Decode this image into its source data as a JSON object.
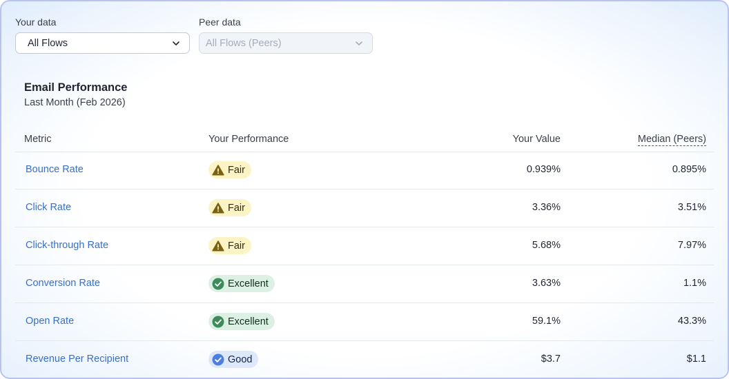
{
  "filters": {
    "your_data_label": "Your data",
    "your_data_value": "All Flows",
    "peer_data_label": "Peer data",
    "peer_data_value": "All Flows (Peers)"
  },
  "card": {
    "title": "Email Performance",
    "subtitle": "Last Month (Feb 2026)"
  },
  "table": {
    "headers": {
      "metric": "Metric",
      "performance": "Your Performance",
      "your_value": "Your Value",
      "median": "Median (Peers)"
    },
    "rows": [
      {
        "metric": "Bounce Rate",
        "rating": "Fair",
        "rating_icon": "warning-icon",
        "your_value": "0.939%",
        "median": "0.895%"
      },
      {
        "metric": "Click Rate",
        "rating": "Fair",
        "rating_icon": "warning-icon",
        "your_value": "3.36%",
        "median": "3.51%"
      },
      {
        "metric": "Click-through Rate",
        "rating": "Fair",
        "rating_icon": "warning-icon",
        "your_value": "5.68%",
        "median": "7.97%"
      },
      {
        "metric": "Conversion Rate",
        "rating": "Excellent",
        "rating_icon": "check-circle-icon",
        "your_value": "3.63%",
        "median": "1.1%"
      },
      {
        "metric": "Open Rate",
        "rating": "Excellent",
        "rating_icon": "check-circle-icon",
        "your_value": "59.1%",
        "median": "43.3%"
      },
      {
        "metric": "Revenue Per Recipient",
        "rating": "Good",
        "rating_icon": "check-circle-icon",
        "your_value": "$3.7",
        "median": "$1.1"
      }
    ]
  },
  "colors": {
    "link": "#3a6fc5",
    "fair_bg": "#fcf4c4",
    "fair_icon": "#7a6212",
    "excellent_bg": "#dcf1e3",
    "excellent_icon": "#3d8a5a",
    "good_bg": "#dde8fb",
    "good_icon": "#4d7fe0",
    "frame_border": "#b9c3f3"
  }
}
